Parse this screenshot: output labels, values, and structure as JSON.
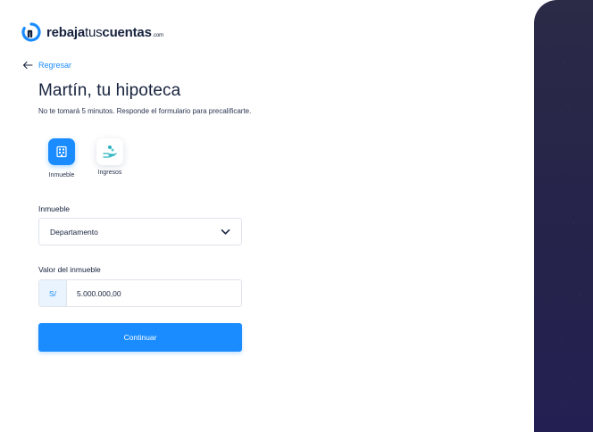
{
  "brand": {
    "name_bold_1": "rebaja",
    "name_light": "tus",
    "name_bold_2": "cuentas",
    "suffix": ".com",
    "accent": "#1a8cff"
  },
  "nav": {
    "back_label": "Regresar"
  },
  "header": {
    "title": "Martín, tu hipoteca",
    "subtitle": "No te tomará 5 minutos. Responde el formulario para precalificarte."
  },
  "steps": [
    {
      "label": "Inmueble",
      "icon": "building-icon",
      "active": true
    },
    {
      "label": "Ingresos",
      "icon": "hand-coins-icon",
      "active": false
    }
  ],
  "form": {
    "property_label": "Inmueble",
    "property_value": "Departamento",
    "value_label": "Valor del inmueble",
    "currency_prefix": "S/",
    "value_amount": "5.000.000,00",
    "submit_label": "Continuar"
  },
  "colors": {
    "primary": "#1a8cff",
    "text": "#16223d",
    "panel": "#27264a"
  }
}
